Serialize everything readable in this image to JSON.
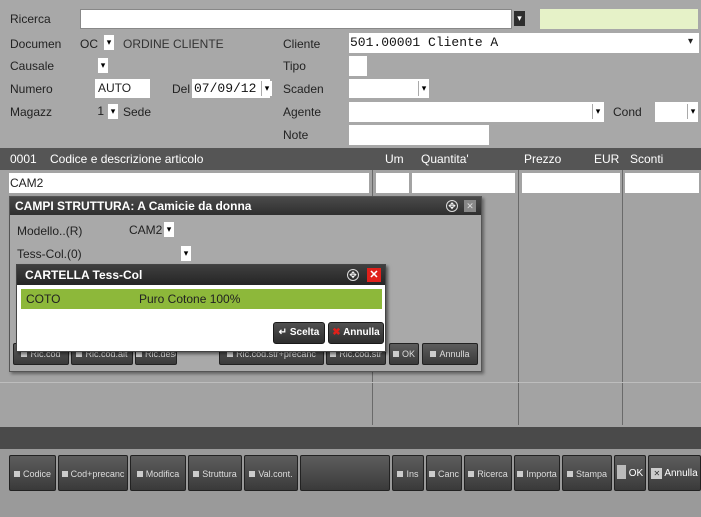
{
  "header": {
    "ricerca_label": "Ricerca",
    "ricerca_value": "",
    "documento_label": "Documen",
    "documento_code": "OC",
    "documento_desc": "ORDINE CLIENTE",
    "causale_label": "Causale",
    "numero_label": "Numero",
    "numero_value": "AUTO",
    "del_label": "Del",
    "del_value": "07/09/12",
    "magazzino_label": "Magazz",
    "magazzino_value": "1",
    "sede_label": "Sede",
    "cliente_label": "Cliente",
    "cliente_value": "501.00001 Cliente A",
    "tipo_label": "Tipo",
    "scadenze_label": "Scaden",
    "agente_label": "Agente",
    "cond_label": "Cond",
    "note_label": "Note"
  },
  "grid": {
    "columns": [
      "0001",
      "Codice e descrizione articolo",
      "Um",
      "Quantita'",
      "Prezzo",
      "EUR",
      "Sconti"
    ],
    "row1_code": "CAM2"
  },
  "campi_dialog": {
    "title": "CAMPI STRUTTURA: A Camicie da donna",
    "modello_label": "Modello..(R)",
    "modello_value": "CAM2",
    "tesscol_label": "Tess-Col.(0)",
    "buttons": [
      "Ric.cod",
      "Ric.cod.alt",
      "Ric.desc",
      "Ric.cod.str+precanc",
      "Ric.cod.str",
      "OK",
      "Annulla"
    ]
  },
  "cartella_dialog": {
    "title": "CARTELLA Tess-Col",
    "item_code": "COTO",
    "item_desc": "Puro Cotone 100%",
    "scelta_label": "Scelta",
    "annulla_label": "Annulla"
  },
  "toolbar": {
    "buttons": [
      "Codice",
      "Cod+precanc",
      "Modifica",
      "Struttura",
      "Val.cont.",
      "Ins",
      "Canc",
      "Ricerca",
      "Importa",
      "Stampa",
      "OK",
      "Annulla"
    ]
  },
  "colors": {
    "highlight_green": "#8db83a",
    "ricerca_green": "#e6f2c8",
    "close_red": "#e0201a"
  }
}
